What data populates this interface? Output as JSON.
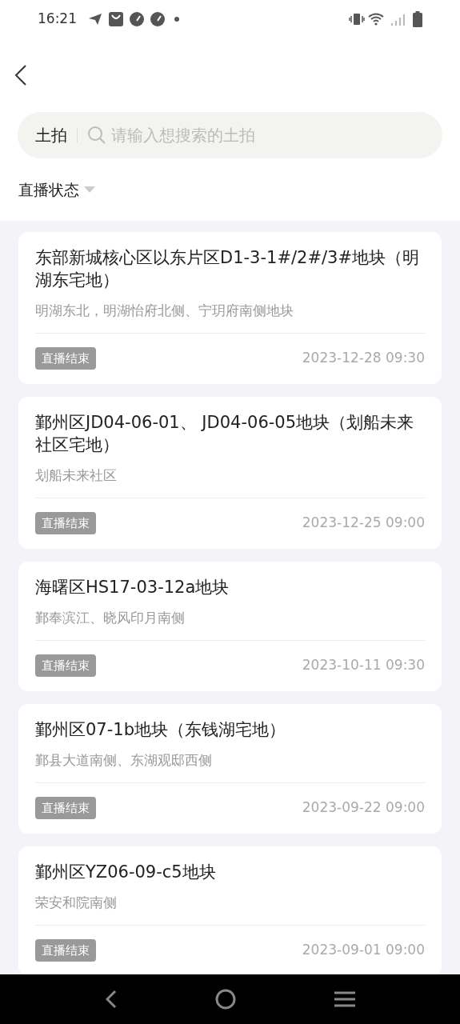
{
  "status_bar": {
    "time": "16:21"
  },
  "search": {
    "category": "土拍",
    "placeholder": "请输入想搜索的土拍"
  },
  "filter": {
    "label": "直播状态"
  },
  "auctions": [
    {
      "title": "东部新城核心区以东片区D1-3-1#/2#/3#地块（明湖东宅地）",
      "location": "明湖东北，明湖怡府北侧、宁玥府南侧地块",
      "status": "直播结束",
      "date": "2023-12-28 09:30"
    },
    {
      "title": "鄞州区JD04-06-01、 JD04-06-05地块（划船未来社区宅地）",
      "location": "划船未来社区",
      "status": "直播结束",
      "date": "2023-12-25 09:00"
    },
    {
      "title": "海曙区HS17-03-12a地块",
      "location": "鄞奉滨江、晓风印月南侧",
      "status": "直播结束",
      "date": "2023-10-11 09:30"
    },
    {
      "title": "鄞州区07-1b地块（东钱湖宅地）",
      "location": "鄞县大道南侧、东湖观邸西侧",
      "status": "直播结束",
      "date": "2023-09-22 09:00"
    },
    {
      "title": "鄞州区YZ06-09-c5地块",
      "location": "荣安和院南侧",
      "status": "直播结束",
      "date": "2023-09-01 09:00"
    }
  ]
}
